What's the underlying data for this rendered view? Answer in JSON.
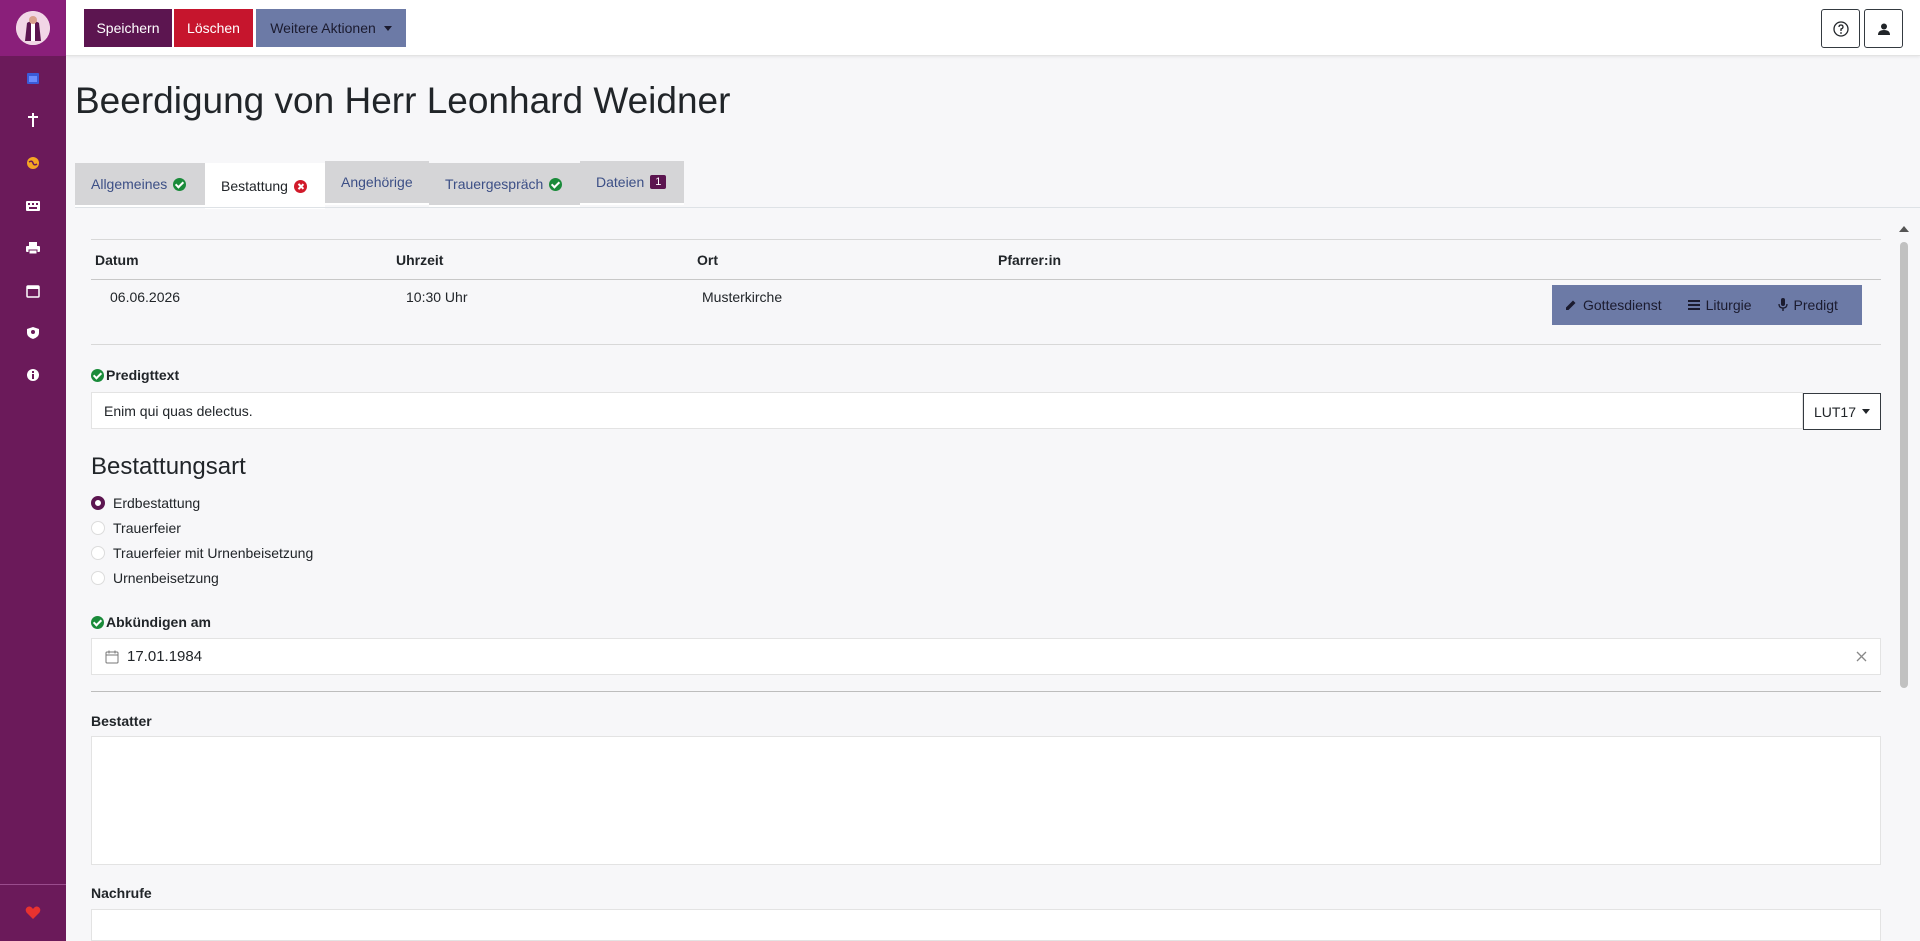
{
  "toolbar": {
    "save_label": "Speichern",
    "delete_label": "Löschen",
    "more_label": "Weitere Aktionen"
  },
  "page": {
    "title": "Beerdigung von Herr Leonhard Weidner"
  },
  "tabs": [
    {
      "label": "Allgemeines",
      "status": "ok"
    },
    {
      "label": "Bestattung",
      "status": "error"
    },
    {
      "label": "Angehörige"
    },
    {
      "label": "Trauergespräch",
      "status": "ok"
    },
    {
      "label": "Dateien",
      "badge": "1"
    }
  ],
  "service_table": {
    "headers": [
      "Datum",
      "Uhrzeit",
      "Ort",
      "Pfarrer:in"
    ],
    "row": {
      "date": "06.06.2026",
      "time": "10:30 Uhr",
      "location": "Musterkirche",
      "pastor": ""
    },
    "actions": [
      "Gottesdienst",
      "Liturgie",
      "Predigt"
    ]
  },
  "sermon": {
    "label": "Predigttext",
    "value": "Enim qui quas delectus.",
    "translation": "LUT17"
  },
  "burial_type": {
    "title": "Bestattungsart",
    "options": [
      "Erdbestattung",
      "Trauerfeier",
      "Trauerfeier mit Urnenbeisetzung",
      "Urnenbeisetzung"
    ],
    "selected": "Erdbestattung"
  },
  "announce": {
    "label": "Abkündigen am",
    "value": "17.01.1984"
  },
  "undertaker": {
    "label": "Bestatter",
    "value": ""
  },
  "obituaries": {
    "label": "Nachrufe",
    "value": ""
  },
  "colors": {
    "sidebar": "#6b1a5a",
    "primary": "#5c1550",
    "danger": "#c6152d",
    "secondary": "#6c7aa6",
    "success": "#1a8b3a"
  }
}
